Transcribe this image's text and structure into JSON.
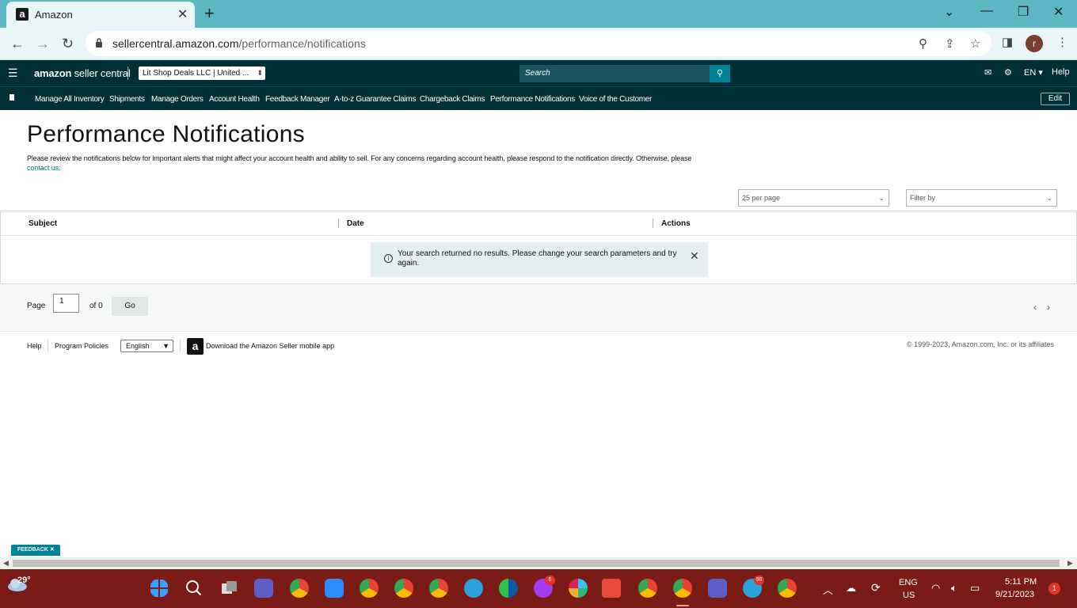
{
  "browser": {
    "tab_title": "Amazon",
    "url_host": "sellercentral.amazon.com",
    "url_path": "/performance/notifications",
    "profile_initial": "r"
  },
  "header": {
    "logo_amazon": "amazon",
    "logo_rest": " seller central",
    "account": "Lit Shop Deals LLC | United ...",
    "search_placeholder": "Search",
    "lang": "EN",
    "help": "Help"
  },
  "nav": {
    "items": [
      "Manage All Inventory",
      "Shipments",
      "Manage Orders",
      "Account Health",
      "Feedback Manager",
      "A-to-z Guarantee Claims",
      "Chargeback Claims",
      "Performance Notifications",
      "Voice of the Customer"
    ],
    "edit": "Edit"
  },
  "main": {
    "title": "Performance Notifications",
    "intro": "Please review the notifications below for important alerts that might affect your account health and ability to sell. For any concerns regarding account health, please respond to the notification directly. Otherwise, please",
    "contact_link": "contact us",
    "per_page": "25 per page",
    "filter_placeholder": "Filter by",
    "columns": [
      "Subject",
      "Date",
      "Actions"
    ],
    "no_results": "Your search returned no results. Please change your search parameters and try again.",
    "pager": {
      "page_label": "Page",
      "page_value": "1",
      "of_label": "of 0",
      "go": "Go"
    }
  },
  "footer": {
    "help": "Help",
    "policies": "Program Policies",
    "language": "English",
    "app": "Download the Amazon Seller mobile app",
    "copyright": "© 1999-2023, Amazon.com, Inc. or its affiliates"
  },
  "feedback": "FEEDBACK ✕",
  "taskbar": {
    "temperature": "29°",
    "lang1": "ENG",
    "lang2": "US",
    "time": "5:11 PM",
    "date": "9/21/2023",
    "notifications": "1",
    "badges": {
      "messenger": "6",
      "telegram": "98"
    }
  },
  "colors": {
    "header_bg": "#002f36",
    "accent": "#008296",
    "taskbar": "#7a1c15",
    "tabbar": "#5db6c4"
  }
}
